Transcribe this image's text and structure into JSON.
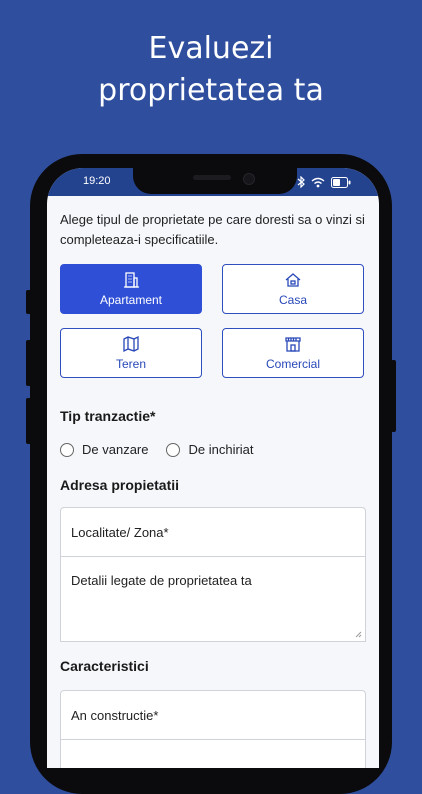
{
  "headline": {
    "line1": "Evaluezi",
    "line2": "proprietatea ta"
  },
  "status_bar": {
    "time": "19:20",
    "icons": [
      "bluetooth-icon",
      "wifi-icon",
      "battery-icon"
    ]
  },
  "intro_text": "Alege tipul de proprietate pe care doresti sa o vinzi si completeaza-i specificatiile.",
  "property_types": [
    {
      "label": "Apartament",
      "icon": "building-icon",
      "selected": true
    },
    {
      "label": "Casa",
      "icon": "house-icon",
      "selected": false
    },
    {
      "label": "Teren",
      "icon": "map-icon",
      "selected": false
    },
    {
      "label": "Comercial",
      "icon": "store-icon",
      "selected": false
    }
  ],
  "transaction": {
    "title": "Tip tranzactie*",
    "options": [
      "De vanzare",
      "De inchiriat"
    ]
  },
  "address": {
    "title": "Adresa propietatii",
    "locality_placeholder": "Localitate/ Zona*",
    "details_placeholder": "Detalii legate de proprietatea ta"
  },
  "characteristics": {
    "title": "Caracteristici",
    "year_placeholder": "An constructie*"
  },
  "colors": {
    "background": "#2f4f9e",
    "accent": "#2f4fd6",
    "status_bar": "#23438f"
  }
}
